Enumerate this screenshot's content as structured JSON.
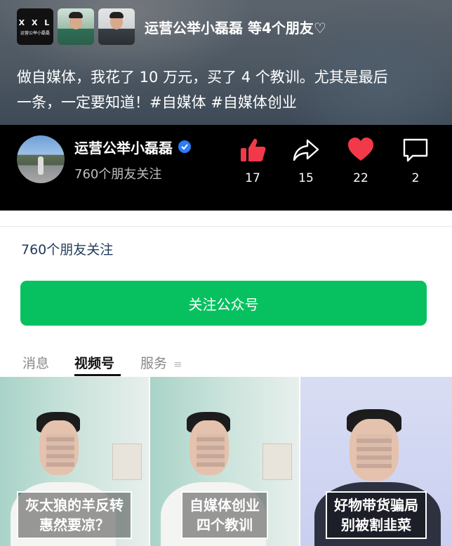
{
  "video": {
    "logo_top": "X X L",
    "logo_bottom": "运营公举小磊磊",
    "friends_text": "运营公举小磊磊 等4个朋友♡",
    "caption_line1": "做自媒体，我花了 10 万元，买了 4 个教训。尤其是最后",
    "caption_line2": "一条，一定要知道！#自媒体 #自媒体创业",
    "author_name": "运营公举小磊磊",
    "author_sub": "760个朋友关注",
    "actions": {
      "like": "17",
      "share": "15",
      "favorite": "22",
      "comment": "2"
    }
  },
  "profile": {
    "friends_follow": "760个朋友关注",
    "follow_button": "关注公众号",
    "tabs": [
      "消息",
      "视频号",
      "服务"
    ],
    "active_tab": "视频号"
  },
  "thumbnails": [
    {
      "line1": "灰太狼的羊反转",
      "line2": "惠然要凉？"
    },
    {
      "line1": "自媒体创业",
      "line2": "四个教训"
    },
    {
      "line1": "好物带货骗局",
      "line2": "别被割韭菜"
    }
  ],
  "colors": {
    "follow_green": "#07c160",
    "like_red": "#f2394a",
    "verify_blue": "#2b7cf6",
    "friends_blue": "#1f3a5a"
  }
}
